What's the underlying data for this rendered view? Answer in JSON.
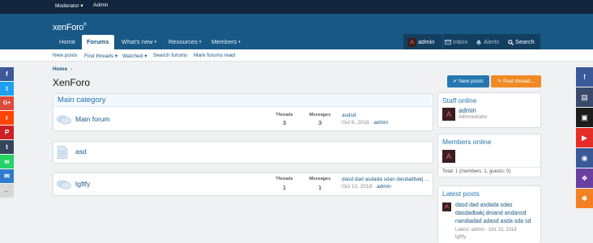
{
  "topbar": {
    "moderator": "Moderator ▾",
    "admin": "Admin"
  },
  "header": {
    "logo_main": "xenForo",
    "logo_tm": "®"
  },
  "nav": {
    "tabs": [
      {
        "label": "Home"
      },
      {
        "label": "Forums"
      },
      {
        "label": "What's new"
      },
      {
        "label": "Resources"
      },
      {
        "label": "Members"
      }
    ],
    "caret": "▾"
  },
  "userbox": {
    "user": "admin",
    "inbox": "Inbox",
    "alerts": "Alerts",
    "search": "Search",
    "avatar_letter": "A"
  },
  "subnav": {
    "items": [
      "New posts",
      "Find threads ▾",
      "Watched ▾",
      "Search forums",
      "Mark forums read"
    ]
  },
  "breadcrumb": {
    "home": "Home",
    "sep": "›"
  },
  "page": {
    "title": "XenForo"
  },
  "buttons": {
    "new_posts": "New posts",
    "post_thread": "Post thread..."
  },
  "category": {
    "title": "Main category"
  },
  "forums": [
    {
      "name": "Main forum",
      "threads_label": "Threads",
      "threads": "3",
      "messages_label": "Messages",
      "messages": "3",
      "last_title": "asdsd",
      "last_date": "Oct 8, 2018 ·",
      "last_user": "admin"
    },
    {
      "name": "asd"
    },
    {
      "name": "tgftfy",
      "threads_label": "Threads",
      "threads": "1",
      "messages_label": "Messages",
      "messages": "1",
      "last_title": "dasd dad asdada sdas dasdadbakj ...",
      "last_date": "Oct 10, 2018 ·",
      "last_user": "admin"
    }
  ],
  "sidebar": {
    "staff": {
      "title": "Staff online",
      "name": "admin",
      "role": "Administrator"
    },
    "members": {
      "title": "Members online",
      "total": "Total: 1 (members: 1, guests: 0)"
    },
    "latest": {
      "title": "Latest posts",
      "line1": "dasd dad asdada sdas",
      "line2": "dasdadbakj dniand andansd",
      "line3": "nandiadad adasd asda sda sd",
      "meta": "Latest: admin · Oct 10, 2018",
      "forum": "tgftfy"
    }
  },
  "share_left": [
    {
      "icon": "facebook-icon",
      "glyph": "f",
      "color": "#3b5998"
    },
    {
      "icon": "twitter-icon",
      "glyph": "t",
      "color": "#1da1f2"
    },
    {
      "icon": "google-plus-icon",
      "glyph": "G+",
      "color": "#dd4b39"
    },
    {
      "icon": "reddit-icon",
      "glyph": "r",
      "color": "#ff4500"
    },
    {
      "icon": "pinterest-icon",
      "glyph": "P",
      "color": "#cb2027"
    },
    {
      "icon": "tumblr-icon",
      "glyph": "t",
      "color": "#35465c"
    },
    {
      "icon": "whatsapp-icon",
      "glyph": "w",
      "color": "#25d366"
    },
    {
      "icon": "email-icon",
      "glyph": "✉",
      "color": "#2e7bcf"
    },
    {
      "icon": "collapse-arrow-icon",
      "glyph": "←",
      "color": "#d8d8d8"
    }
  ],
  "share_right": [
    {
      "icon": "facebook-icon",
      "glyph": "f",
      "color": "#3b5998"
    },
    {
      "icon": "book-icon",
      "glyph": "▤",
      "color": "#3a4a6b"
    },
    {
      "icon": "image-icon",
      "glyph": "▣",
      "color": "#1c1c1c"
    },
    {
      "icon": "youtube-icon",
      "glyph": "▶",
      "color": "#e52d27"
    },
    {
      "icon": "eye-icon",
      "glyph": "◉",
      "color": "#3b5998"
    },
    {
      "icon": "gift-icon",
      "glyph": "❖",
      "color": "#6a3fa0"
    },
    {
      "icon": "puzzle-icon",
      "glyph": "✱",
      "color": "#f48024"
    }
  ]
}
